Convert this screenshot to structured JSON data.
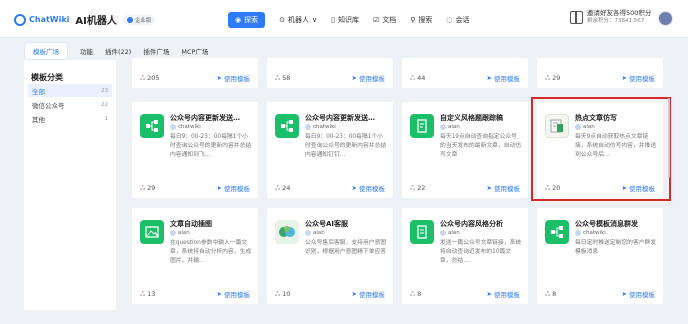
{
  "header": {
    "logo_text": "ChatWiki",
    "app_name": "AI机器人",
    "badge": "企业版",
    "nav": [
      {
        "label": "探索",
        "icon": "compass-icon",
        "active": true
      },
      {
        "label": "机器人",
        "icon": "robot-icon",
        "active": false
      },
      {
        "label": "知识库",
        "icon": "book-icon",
        "active": false
      },
      {
        "label": "文档",
        "icon": "document-icon",
        "active": false
      },
      {
        "label": "搜索",
        "icon": "search-icon",
        "active": false
      },
      {
        "label": "会话",
        "icon": "chat-icon",
        "active": false
      }
    ],
    "invite_title": "邀请好友各得500积分",
    "invite_points": "剩余积分：73841.567"
  },
  "subtabs": [
    "模板广场",
    "功能",
    "插件(22)",
    "插件广场",
    "MCP广场"
  ],
  "sidebar": {
    "title": "模板分类",
    "items": [
      {
        "label": "全部",
        "count": "23"
      },
      {
        "label": "微信公众号",
        "count": "22"
      },
      {
        "label": "其他",
        "count": "1"
      }
    ]
  },
  "use_label": "使用模板",
  "top_row": [
    "205",
    "58",
    "44",
    "29"
  ],
  "cards": [
    {
      "title": "公众号内容更新发送…",
      "author": "chatwiki",
      "desc": "每日9：00-23：00每隔1个小时查询公众号的更新内容并总结内容通知到飞…",
      "uses": "29"
    },
    {
      "title": "公众号内容更新发送…",
      "author": "chatwiki",
      "desc": "每日9：00-23：00每隔1个小时查询公众号的更新内容并总结内容通知钉钉…",
      "uses": "24"
    },
    {
      "title": "自定义风格题跟踪稿",
      "author": "alan",
      "desc": "每天19点自动查询指定公众号的当天发布的最新文章，自动仿写文章",
      "uses": "22"
    },
    {
      "title": "热点文章仿写",
      "author": "alan",
      "desc": "每天9点自动获取热点文章链接，系统自动仿写内容，并推送到公众号后…",
      "uses": "20"
    },
    {
      "title": "文章自动插图",
      "author": "alan",
      "desc": "在question参数中输入一篇文章，系统将自动分析内容，生成图片，并输…",
      "uses": "13"
    },
    {
      "title": "公众号AI客服",
      "author": "alan",
      "desc": "公众号售后客服，支持用户意图识别，根据用户意图精下单应答",
      "uses": "10"
    },
    {
      "title": "公众号内容风格分析",
      "author": "alan",
      "desc": "发送一篇公众号文章链接，系统将自动查询近发布的10篇文章，总结…",
      "uses": "8"
    },
    {
      "title": "公众号模板消息群发",
      "author": "chatwiki",
      "desc": "每日定时推送定制您的客户群发模板消息",
      "uses": "8"
    }
  ]
}
